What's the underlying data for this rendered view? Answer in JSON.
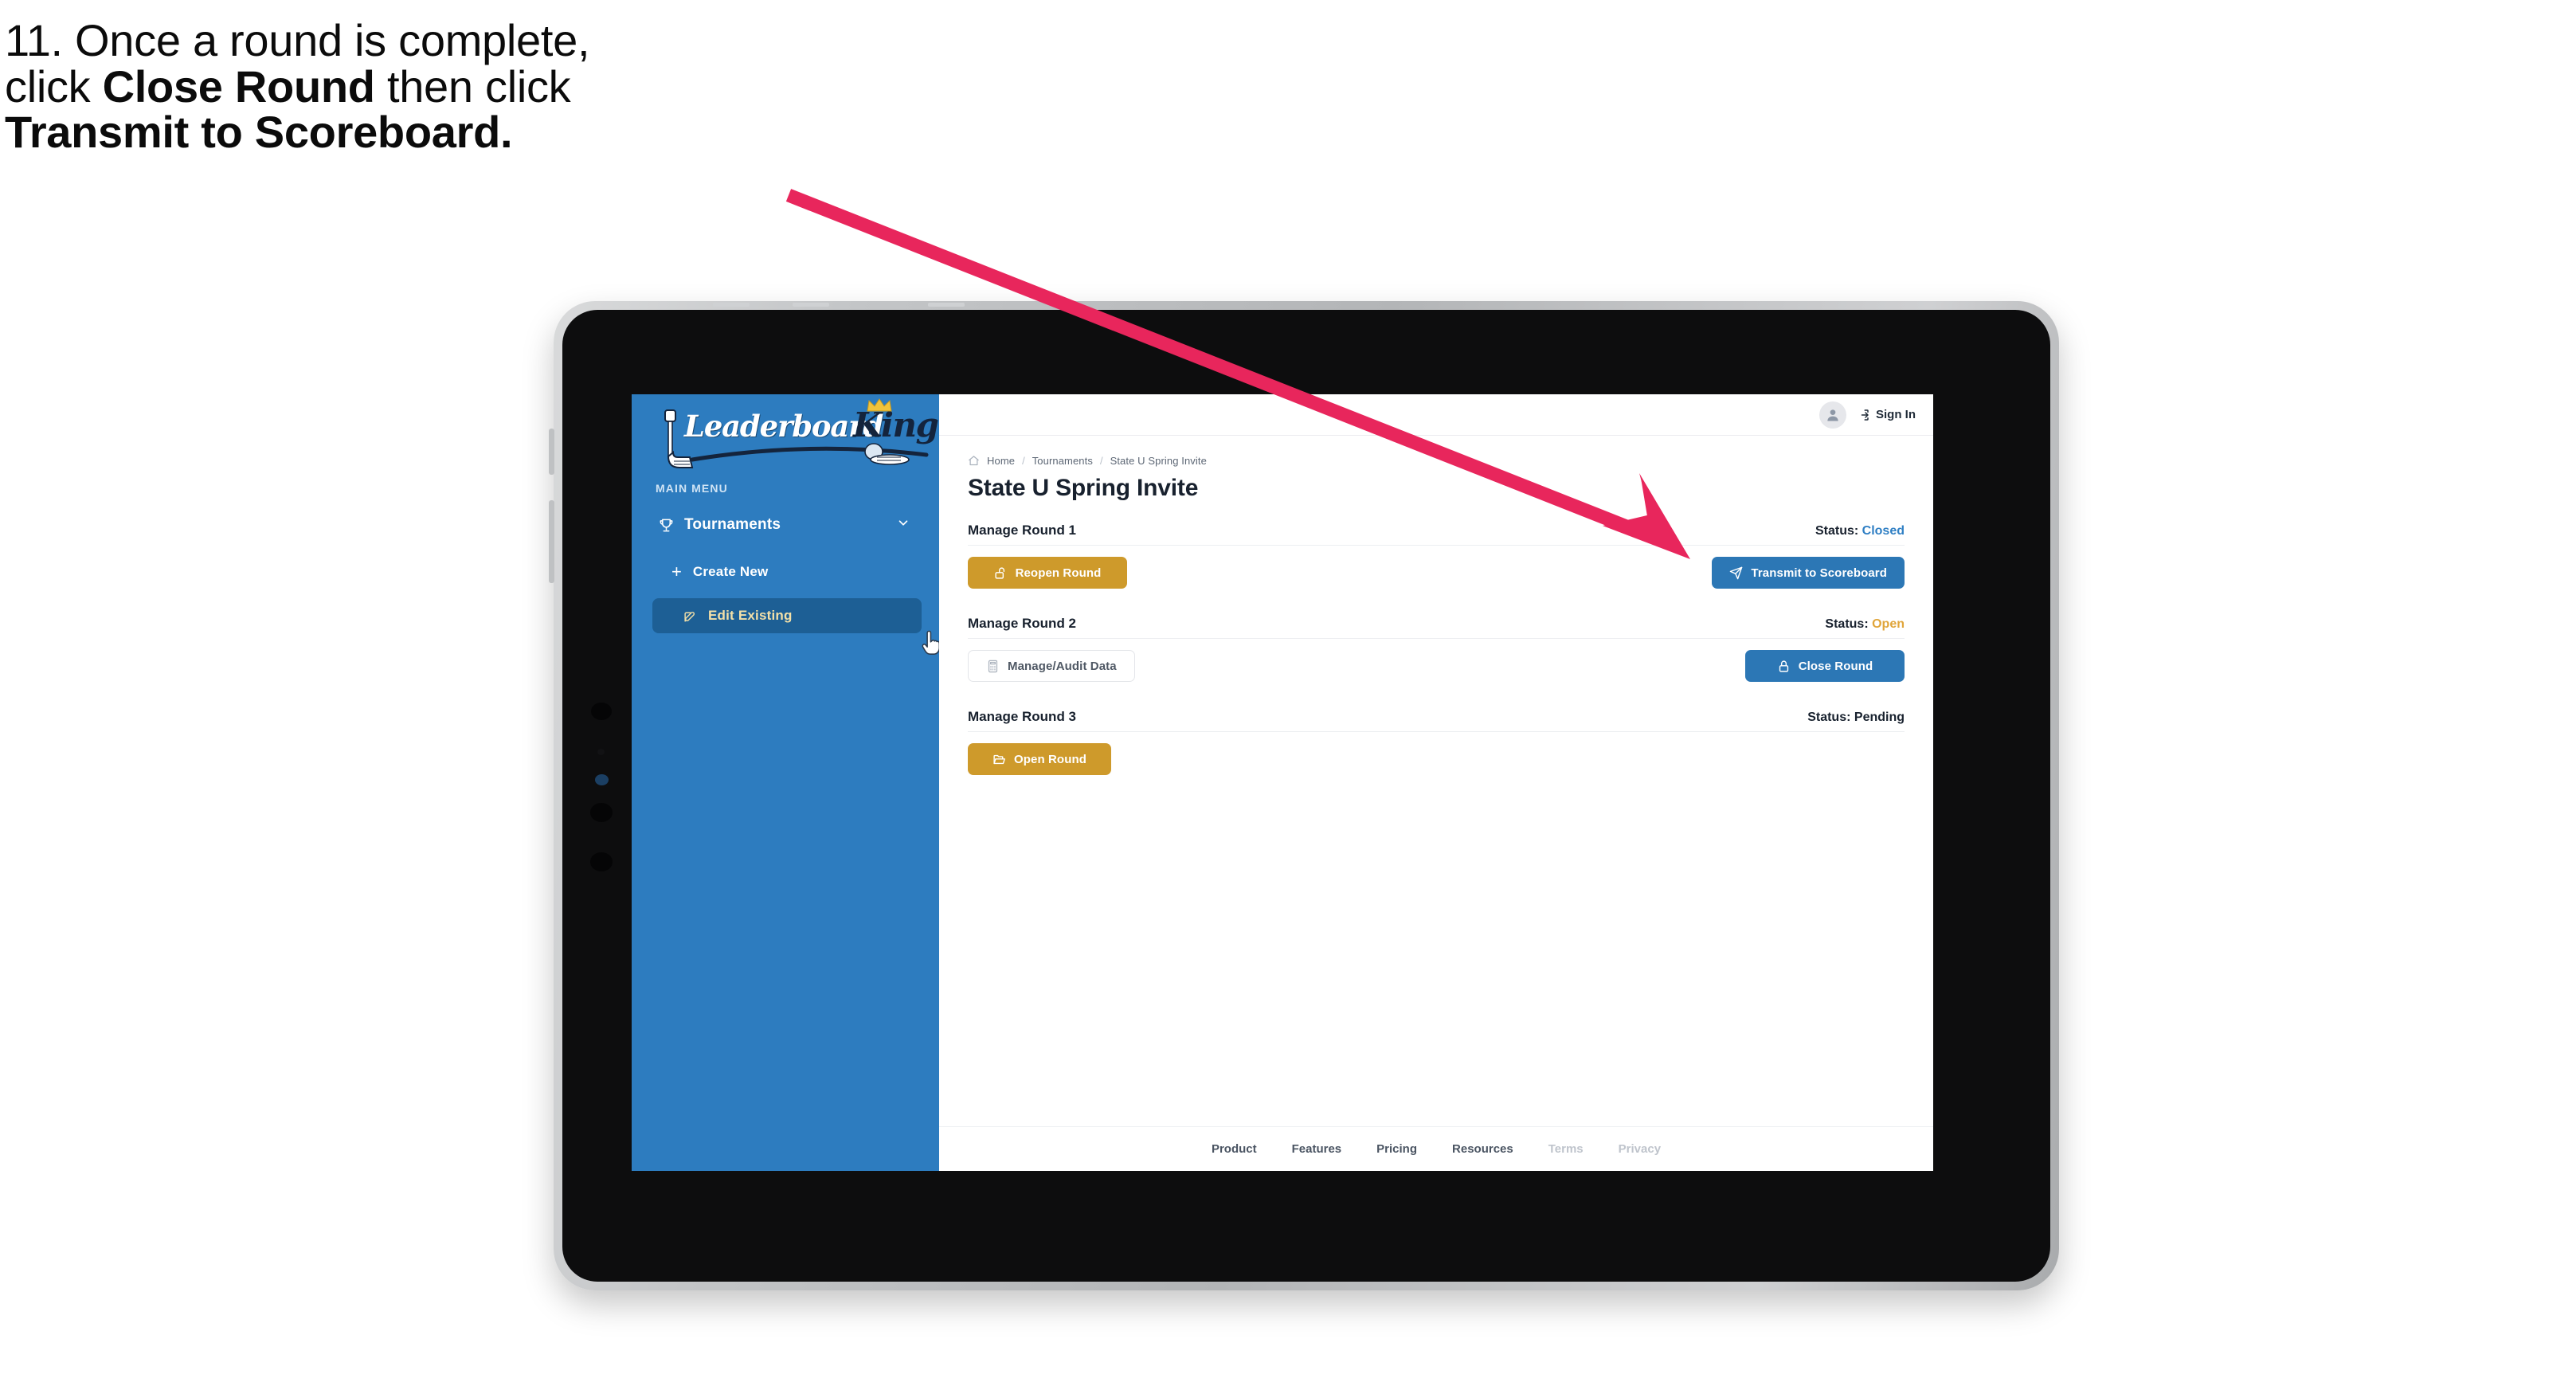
{
  "caption": {
    "line1": "11. Once a round is complete,",
    "line2_pre": "click ",
    "line2_bold": "Close Round",
    "line2_post": " then click",
    "line3_bold": "Transmit to Scoreboard."
  },
  "colors": {
    "arrow": "#e8265c",
    "sidebar_blue": "#2d7cbf",
    "sidebar_active": "#1d5f95",
    "sidebar_active_text": "#f3e0a8",
    "gold": "#ce9a2b",
    "blue_button": "#2c77b5",
    "status_closed": "#2f7fc4",
    "status_open": "#e0a53a",
    "tablet_bezel": "#0d0d0e",
    "tablet_frame": "#c3c5c7"
  },
  "sidebar": {
    "logo": {
      "word_one": "Leaderboard",
      "word_two": "King",
      "icons": [
        "golf-putter-icon",
        "crown-icon",
        "golf-ball-icon"
      ]
    },
    "section_label": "MAIN MENU",
    "items": [
      {
        "label": "Tournaments",
        "icon": "trophy-icon",
        "expander": "chevron-down-icon",
        "active": false
      },
      {
        "label": "Create New",
        "icon": "plus-icon",
        "active": false
      },
      {
        "label": "Edit Existing",
        "icon": "edit-square-icon",
        "active": true
      }
    ],
    "cursor": "pointing-hand-cursor"
  },
  "topbar": {
    "avatar_icon": "user-avatar-icon",
    "signin_icon": "sign-in-arrow-icon",
    "signin_label": "Sign In"
  },
  "breadcrumb": {
    "home_icon": "home-icon",
    "items": [
      "Home",
      "Tournaments",
      "State U Spring Invite"
    ],
    "separator": "/"
  },
  "page": {
    "title": "State U Spring Invite"
  },
  "rounds": [
    {
      "title": "Manage Round 1",
      "status_label": "Status:",
      "status_value": "Closed",
      "status_class": "st-closed",
      "left_button": {
        "label": "Reopen Round",
        "icon": "unlock-icon",
        "style": "gold"
      },
      "right_button": {
        "label": "Transmit to Scoreboard",
        "icon": "paper-plane-icon",
        "style": "blue"
      }
    },
    {
      "title": "Manage Round 2",
      "status_label": "Status:",
      "status_value": "Open",
      "status_class": "st-open",
      "left_button": {
        "label": "Manage/Audit Data",
        "icon": "calculator-icon",
        "style": "ghost"
      },
      "right_button": {
        "label": "Close Round",
        "icon": "lock-icon",
        "style": "blue"
      }
    },
    {
      "title": "Manage Round 3",
      "status_label": "Status:",
      "status_value": "Pending",
      "status_class": "st-pending",
      "left_button": {
        "label": "Open Round",
        "icon": "folder-open-icon",
        "style": "gold"
      },
      "right_button": null
    }
  ],
  "footer": {
    "links": [
      {
        "label": "Product",
        "muted": false
      },
      {
        "label": "Features",
        "muted": false
      },
      {
        "label": "Pricing",
        "muted": false
      },
      {
        "label": "Resources",
        "muted": false
      },
      {
        "label": "Terms",
        "muted": true
      },
      {
        "label": "Privacy",
        "muted": true
      }
    ]
  }
}
